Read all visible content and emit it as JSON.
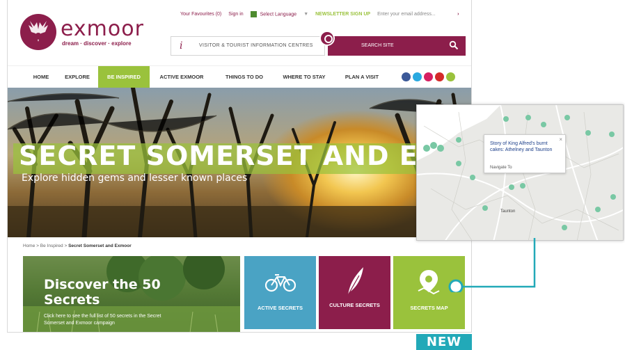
{
  "header": {
    "logo_word": "exmoor",
    "logo_tagline": "dream · discover · explore",
    "favourites": "Your Favourites (0)",
    "sign_in": "Sign in",
    "select_language": "Select Language",
    "language_arrow": "▼",
    "newsletter": "NEWSLETTER SIGN UP",
    "email_placeholder": "Enter your email address...",
    "email_submit": "›",
    "vic_icon": "i",
    "vic_label": "VISITOR & TOURIST INFORMATION CENTRES",
    "search_placeholder": "SEARCH SITE"
  },
  "nav": {
    "items": [
      {
        "label": "HOME",
        "active": false
      },
      {
        "label": "EXPLORE",
        "active": false
      },
      {
        "label": "BE INSPIRED",
        "active": true
      },
      {
        "label": "ACTIVE EXMOOR",
        "active": false
      },
      {
        "label": "THINGS TO DO",
        "active": false
      },
      {
        "label": "WHERE TO STAY",
        "active": false
      },
      {
        "label": "PLAN A VISIT",
        "active": false
      }
    ],
    "social": [
      {
        "icon": "facebook-icon",
        "color": "#3b5998"
      },
      {
        "icon": "twitter-icon",
        "color": "#2aa9e0"
      },
      {
        "icon": "flickr-icon",
        "color": "#d61f61"
      },
      {
        "icon": "youtube-icon",
        "color": "#d42a2a"
      },
      {
        "icon": "rss-icon",
        "color": "#9ac23c"
      }
    ]
  },
  "hero": {
    "title": "SECRET SOMERSET AND EXMOOR",
    "subtitle": "Explore hidden gems and lesser known places"
  },
  "breadcrumb": {
    "home": "Home",
    "sep1": ">",
    "parent": "Be Inspired",
    "sep2": ">",
    "current": "Secret Somerset and Exmoor"
  },
  "discover": {
    "title": "Discover the 50 Secrets",
    "link_text": "Click here to see the full list of 50 secrets in the Secret Somerset and Exmoor campaign"
  },
  "tiles": [
    {
      "label": "ACTIVE SECRETS",
      "color": "#4aa3c4",
      "icon": "bicycle-icon"
    },
    {
      "label": "CULTURE SECRETS",
      "color": "#8c1e4b",
      "icon": "feather-icon"
    },
    {
      "label": "SECRETS MAP",
      "color": "#9ac23c",
      "icon": "map-pin-icon"
    }
  ],
  "map": {
    "popup_title": "Story of King Alfred's burnt cakes: Athelney and Taunton",
    "popup_link": "Navigate To",
    "popup_close": "×",
    "place_labels": [
      "Taunton"
    ]
  },
  "badge": {
    "label": "NEW"
  },
  "colors": {
    "brand": "#8c1e4b",
    "accent_green": "#9ac23c",
    "callout_teal": "#22a9b8"
  }
}
